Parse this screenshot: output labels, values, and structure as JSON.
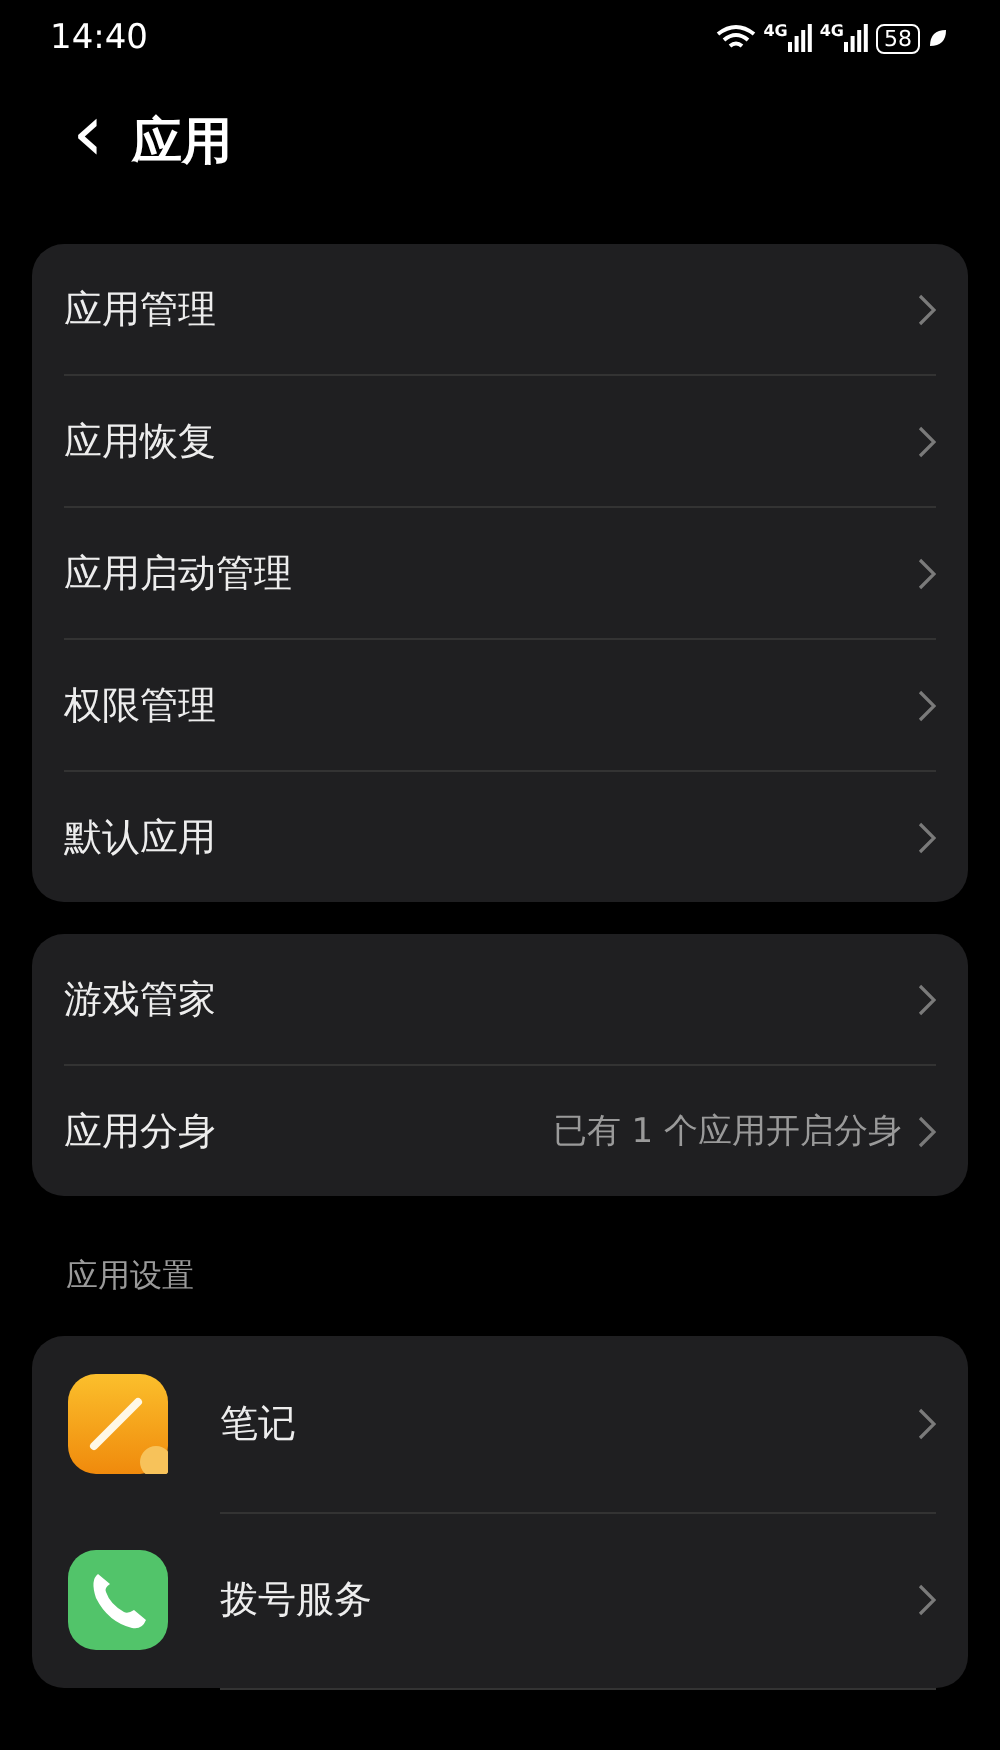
{
  "status_bar": {
    "time": "14:40",
    "network_labels": [
      "4G",
      "4G"
    ],
    "battery": "58"
  },
  "header": {
    "back": "‹",
    "title": "应用"
  },
  "groups": [
    {
      "items": [
        {
          "label": "应用管理"
        },
        {
          "label": "应用恢复"
        },
        {
          "label": "应用启动管理"
        },
        {
          "label": "权限管理"
        },
        {
          "label": "默认应用"
        }
      ]
    },
    {
      "items": [
        {
          "label": "游戏管家"
        },
        {
          "label": "应用分身",
          "value": "已有 1 个应用开启分身"
        }
      ]
    }
  ],
  "app_settings": {
    "heading": "应用设置",
    "items": [
      {
        "label": "笔记"
      },
      {
        "label": "拨号服务"
      }
    ]
  }
}
